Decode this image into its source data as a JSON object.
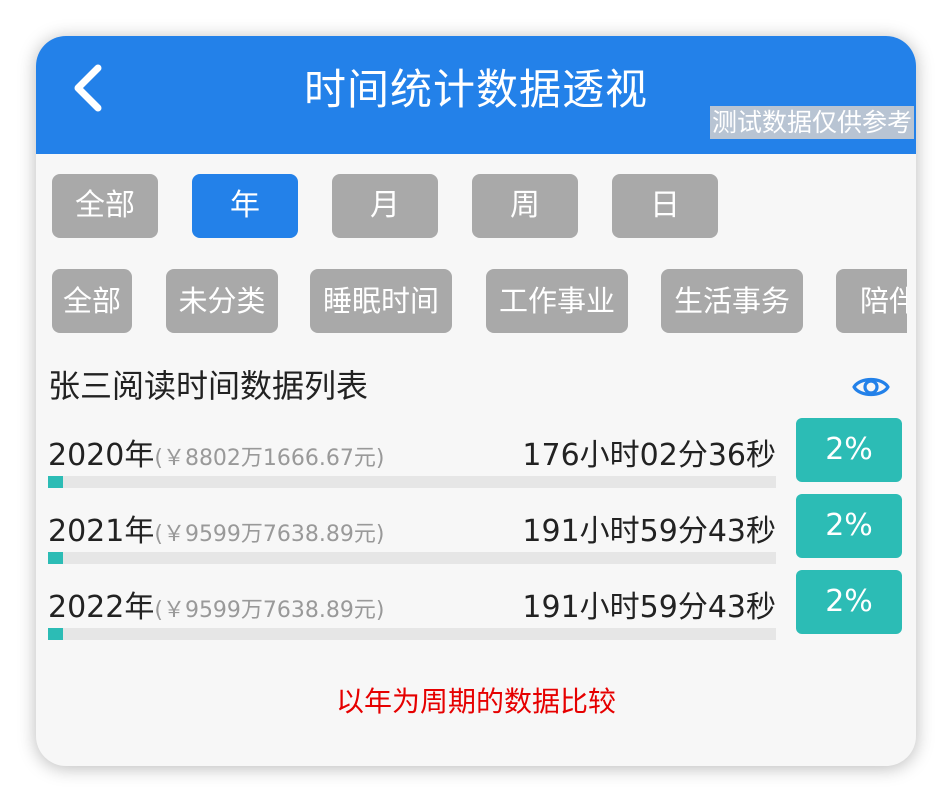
{
  "header": {
    "title": "时间统计数据透视",
    "back_icon": "chevron-left-icon",
    "watermark": "测试数据仅供参考",
    "color": "#2381e9"
  },
  "period_tabs": [
    {
      "label": "全部",
      "active": false
    },
    {
      "label": "年",
      "active": true
    },
    {
      "label": "月",
      "active": false
    },
    {
      "label": "周",
      "active": false
    },
    {
      "label": "日",
      "active": false
    }
  ],
  "categories": [
    {
      "label": "全部"
    },
    {
      "label": "未分类"
    },
    {
      "label": "睡眠时间"
    },
    {
      "label": "工作事业"
    },
    {
      "label": "生活事务"
    },
    {
      "label": "陪伴"
    }
  ],
  "section": {
    "title": "张三阅读时间数据列表",
    "toggle_icon": "eye-icon"
  },
  "rows": [
    {
      "year": "2020年",
      "amount": "(￥8802万1666.67元)",
      "duration": "176小时02分36秒",
      "percent": "2%",
      "progress": 0.02
    },
    {
      "year": "2021年",
      "amount": "(￥9599万7638.89元)",
      "duration": "191小时59分43秒",
      "percent": "2%",
      "progress": 0.02
    },
    {
      "year": "2022年",
      "amount": "(￥9599万7638.89元)",
      "duration": "191小时59分43秒",
      "percent": "2%",
      "progress": 0.02
    }
  ],
  "footer_note": "以年为周期的数据比较",
  "colors": {
    "accent": "#2381e9",
    "teal": "#2cbcb5",
    "inactive": "#a9a9a9",
    "note": "#e60000"
  }
}
